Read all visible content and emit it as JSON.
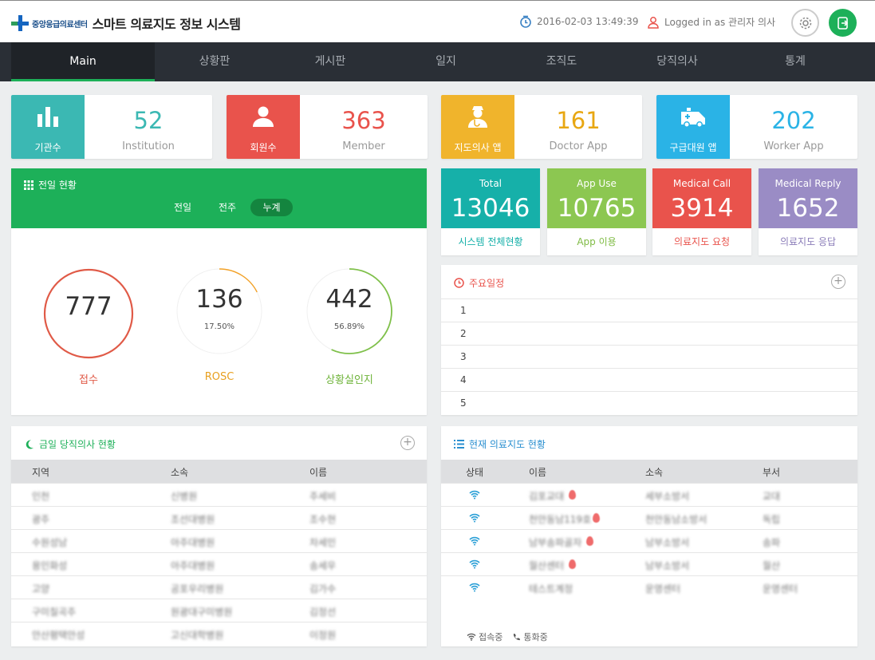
{
  "header": {
    "org_name": "중앙응급의료센터",
    "title": "스마트 의료지도 정보 시스템",
    "datetime": "2016-02-03 13:49:39",
    "user": "Logged in as 관리자 의사"
  },
  "nav": [
    "Main",
    "상황판",
    "게시판",
    "일지",
    "조직도",
    "당직의사",
    "통계"
  ],
  "stats": [
    {
      "label": "기관수",
      "value": "52",
      "sub": "Institution",
      "color": "#3bb8b3",
      "value_color": "#3bb8b3",
      "icon": "bar-chart-icon"
    },
    {
      "label": "회원수",
      "value": "363",
      "sub": "Member",
      "color": "#e9534c",
      "value_color": "#e9534c",
      "icon": "person-icon"
    },
    {
      "label": "지도의사 앱",
      "value": "161",
      "sub": "Doctor App",
      "color": "#f0b42c",
      "value_color": "#e8a712",
      "icon": "doctor-icon"
    },
    {
      "label": "구급대원 앱",
      "value": "202",
      "sub": "Worker App",
      "color": "#2ab3e6",
      "value_color": "#2ab3e6",
      "icon": "ambulance-icon"
    }
  ],
  "today": {
    "title": "전일 현황",
    "tabs": [
      "전일",
      "전주",
      "누계"
    ],
    "active_tab": "누계",
    "gauges": [
      {
        "value": "777",
        "pct": "",
        "label": "접수",
        "color": "#e05a47",
        "fraction": 1.0
      },
      {
        "value": "136",
        "pct": "17.50%",
        "label": "ROSC",
        "color": "#f2a127",
        "fraction": 0.175
      },
      {
        "value": "442",
        "pct": "56.89%",
        "label": "상황실인지",
        "color": "#7fc04a",
        "fraction": 0.5689
      }
    ]
  },
  "metrics": [
    {
      "title": "Total",
      "value": "13046",
      "caption": "시스템 전체현황",
      "color": "#16b0a9",
      "caption_color": "#16b0a9"
    },
    {
      "title": "App Use",
      "value": "10765",
      "caption": "App 이용",
      "color": "#8cc751",
      "caption_color": "#7fbb44"
    },
    {
      "title": "Medical Call",
      "value": "3914",
      "caption": "의료지도 요청",
      "color": "#e9534c",
      "caption_color": "#e9534c"
    },
    {
      "title": "Medical Reply",
      "value": "1652",
      "caption": "의료지도 응답",
      "color": "#9a8cc5",
      "caption_color": "#8a7cb8"
    }
  ],
  "schedule": {
    "title": "주요일정",
    "rows": [
      "1",
      "2",
      "3",
      "4",
      "5"
    ]
  },
  "duty": {
    "title": "금일 당직의사 현황",
    "columns": [
      "지역",
      "소속",
      "이름"
    ],
    "rows": [
      [
        "인천",
        "신병원",
        "주세비"
      ],
      [
        "광주",
        "조선대병원",
        "조수현"
      ],
      [
        "수원성남",
        "아주대병원",
        "차세민"
      ],
      [
        "용인화성",
        "아주대병원",
        "송세우"
      ],
      [
        "고양",
        "공포우리병원",
        "김가수"
      ],
      [
        "구미칠곡주",
        "원광대구미병원",
        "김정선"
      ],
      [
        "안산평택안성",
        "고신대학병원",
        "이정원"
      ]
    ]
  },
  "guidance": {
    "title": "현재 의료지도 현황",
    "columns": [
      "상태",
      "이름",
      "소속",
      "부서"
    ],
    "rows": [
      [
        "김포교대",
        "세부소방서",
        "교대"
      ],
      [
        "천안동남119호",
        "천안동남소방서",
        "독립"
      ],
      [
        "남부송파골자",
        "남부소방서",
        "송파"
      ],
      [
        "월산센터",
        "남부소방서",
        "월산"
      ],
      [
        "테스트계정",
        "운영센터",
        "운영센터"
      ]
    ],
    "legend_connect": "접속중",
    "legend_call": "통화중"
  }
}
